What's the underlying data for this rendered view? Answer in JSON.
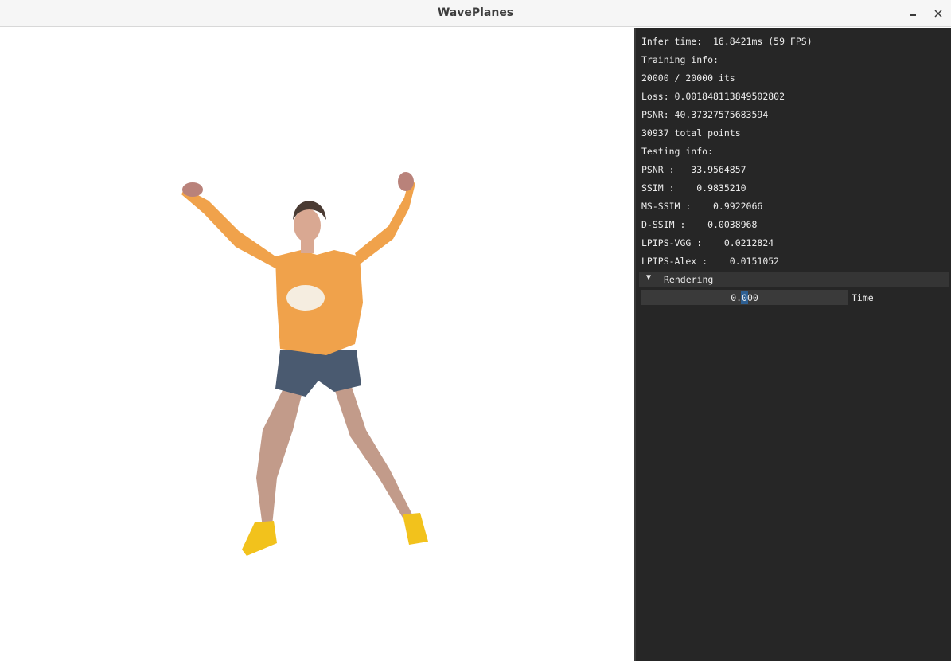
{
  "window": {
    "title": "WavePlanes"
  },
  "viewport": {
    "content": "rendered-3d-human-figure"
  },
  "panel": {
    "infer_time": "Infer time:  16.8421ms (59 FPS)",
    "training_header": "Training info:",
    "iterations": "20000 / 20000 its",
    "loss": "Loss: 0.001848113849502802",
    "train_psnr": "PSNR: 40.37327575683594",
    "total_points": "30937 total points",
    "testing_header": "Testing info:",
    "test_psnr": "PSNR :   33.9564857",
    "ssim": "SSIM :    0.9835210",
    "ms_ssim": "MS-SSIM :    0.9922066",
    "d_ssim": "D-SSIM :    0.0038968",
    "lpips_vgg": "LPIPS-VGG :    0.0212824",
    "lpips_alex": "LPIPS-Alex :    0.0151052",
    "rendering_section": {
      "label": "Rendering",
      "arrow": "▼"
    },
    "time_slider": {
      "value": "0.000",
      "label": "Time"
    }
  },
  "colors": {
    "panel_bg": "#262626",
    "accent": "#2d5f92",
    "sweater": "#f0a24b",
    "shorts": "#4a5a70",
    "shoes": "#f2c21c"
  }
}
